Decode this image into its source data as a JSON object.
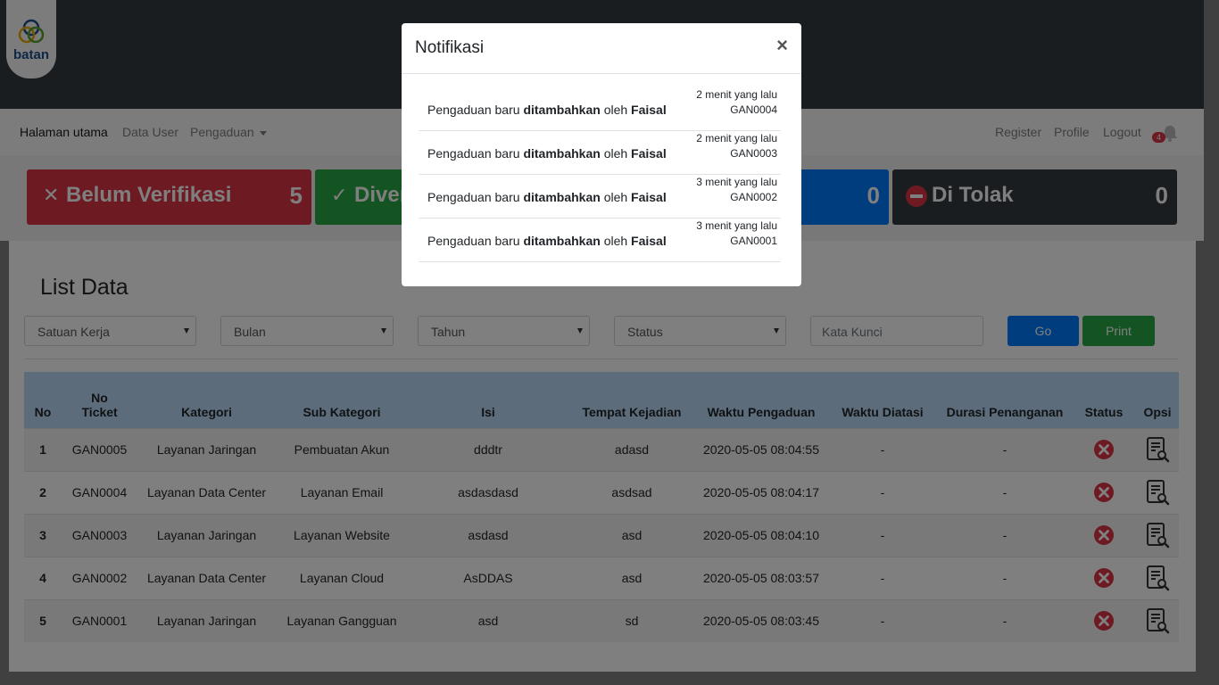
{
  "brand": {
    "logo_text": "batan"
  },
  "nav": {
    "left": [
      "Halaman utama",
      "Data User",
      "Pengaduan"
    ],
    "right": [
      "Register",
      "Profile",
      "Logout"
    ],
    "notif_count": "4"
  },
  "stats": [
    {
      "icon": "x-icon",
      "label": "Belum Verifikasi",
      "count": "5",
      "color": "#dc3545"
    },
    {
      "icon": "check-icon",
      "label": "Diverifikasi",
      "count": "",
      "color": "#28a745"
    },
    {
      "icon": "",
      "label": "",
      "count": "0",
      "color": "#007bff"
    },
    {
      "icon": "no-entry-icon",
      "label": "Di Tolak",
      "count": "0",
      "color": "#343a40"
    }
  ],
  "list": {
    "title": "List Data",
    "filters": {
      "satker": "Satuan Kerja",
      "bulan": "Bulan",
      "tahun": "Tahun",
      "status": "Status"
    },
    "search_placeholder": "Kata Kunci",
    "go_label": "Go",
    "print_label": "Print"
  },
  "table": {
    "headers": [
      "No",
      "No Ticket",
      "Kategori",
      "Sub Kategori",
      "Isi",
      "Tempat Kejadian",
      "Waktu Pengaduan",
      "Waktu Diatasi",
      "Durasi Penanganan",
      "Status",
      "Opsi"
    ],
    "rows": [
      [
        "1",
        "GAN0005",
        "Layanan Jaringan",
        "Pembuatan Akun",
        "dddtr",
        "adasd",
        "2020-05-05 08:04:55",
        "-",
        "-"
      ],
      [
        "2",
        "GAN0004",
        "Layanan Data Center",
        "Layanan Email",
        "asdasdasd",
        "asdsad",
        "2020-05-05 08:04:17",
        "-",
        "-"
      ],
      [
        "3",
        "GAN0003",
        "Layanan Jaringan",
        "Layanan Website",
        "asdasd",
        "asd",
        "2020-05-05 08:04:10",
        "-",
        "-"
      ],
      [
        "4",
        "GAN0002",
        "Layanan Data Center",
        "Layanan Cloud",
        "AsDDAS",
        "asd",
        "2020-05-05 08:03:57",
        "-",
        "-"
      ],
      [
        "5",
        "GAN0001",
        "Layanan Jaringan",
        "Layanan Gangguan",
        "asd",
        "sd",
        "2020-05-05 08:03:45",
        "-",
        "-"
      ]
    ]
  },
  "modal": {
    "title": "Notifikasi",
    "close": "×",
    "msg_prefix": "Pengaduan baru",
    "msg_action": "ditambahkan",
    "msg_by": "oleh",
    "items": [
      {
        "user": "Faisal",
        "time": "2 menit yang lalu",
        "ticket": "GAN0004"
      },
      {
        "user": "Faisal",
        "time": "2 menit yang lalu",
        "ticket": "GAN0003"
      },
      {
        "user": "Faisal",
        "time": "3 menit yang lalu",
        "ticket": "GAN0002"
      },
      {
        "user": "Faisal",
        "time": "3 menit yang lalu",
        "ticket": "GAN0001"
      }
    ]
  },
  "colors": {
    "accent_blue": "#007bff",
    "success": "#28a745",
    "danger": "#dc3545",
    "dark": "#343a40",
    "table_header": "#b9d8f7"
  }
}
